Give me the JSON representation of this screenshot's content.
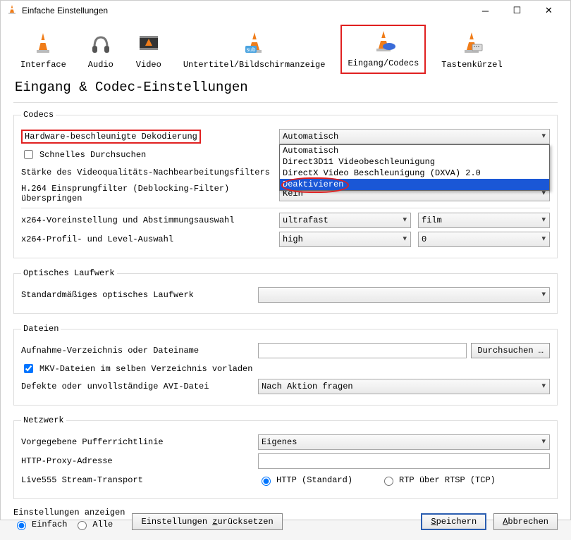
{
  "window": {
    "title": "Einfache Einstellungen"
  },
  "tabs": {
    "interface": "Interface",
    "audio": "Audio",
    "video": "Video",
    "subtitles": "Untertitel/Bildschirmanzeige",
    "input": "Eingang/Codecs",
    "hotkeys": "Tastenkürzel"
  },
  "heading": "Eingang & Codec-Einstellungen",
  "codecs": {
    "legend": "Codecs",
    "hw_decode_label": "Hardware-beschleunigte Dekodierung",
    "hw_decode_value": "Automatisch",
    "hw_decode_options": {
      "auto": "Automatisch",
      "d3d11": "Direct3D11 Videobeschleunigung",
      "dxva": "DirectX Video Beschleunigung (DXVA) 2.0",
      "disable": "Deaktivieren"
    },
    "fast_seek_label": "Schnelles Durchsuchen",
    "fast_seek_checked": false,
    "postproc_label": "Stärke des Videoqualitäts-Nachbearbeitungsfilters",
    "postproc_value": "",
    "h264_skip_label": "H.264 Einsprungfilter (Deblocking-Filter) überspringen",
    "h264_skip_value": "Kein",
    "x264_preset_label": "x264-Voreinstellung und Abstimmungsauswahl",
    "x264_preset_value": "ultrafast",
    "x264_tune_value": "film",
    "x264_profile_label": "x264-Profil- und Level-Auswahl",
    "x264_profile_value": "high",
    "x264_level_value": "0"
  },
  "optical": {
    "legend": "Optisches Laufwerk",
    "default_label": "Standardmäßiges optisches Laufwerk",
    "default_value": ""
  },
  "files": {
    "legend": "Dateien",
    "record_dir_label": "Aufnahme-Verzeichnis oder Dateiname",
    "record_dir_value": "",
    "browse_label": "Durchsuchen …",
    "mkv_preload_label": "MKV-Dateien im selben Verzeichnis vorladen",
    "mkv_preload_checked": true,
    "avi_label": "Defekte oder unvollständige AVI-Datei",
    "avi_value": "Nach Aktion fragen"
  },
  "network": {
    "legend": "Netzwerk",
    "buffer_label": "Vorgegebene Pufferrichtlinie",
    "buffer_value": "Eigenes",
    "proxy_label": "HTTP-Proxy-Adresse",
    "proxy_value": "",
    "live555_label": "Live555 Stream-Transport",
    "live555_http": "HTTP (Standard)",
    "live555_rtp": "RTP über RTSP (TCP)"
  },
  "bottom": {
    "show_settings_label": "Einstellungen anzeigen",
    "simple": "Einfach",
    "all": "Alle",
    "reset": "Einstellungen zurücksetzen",
    "save": "Speichern",
    "save_u": "S",
    "cancel": "Abbrechen",
    "cancel_u": "A"
  }
}
